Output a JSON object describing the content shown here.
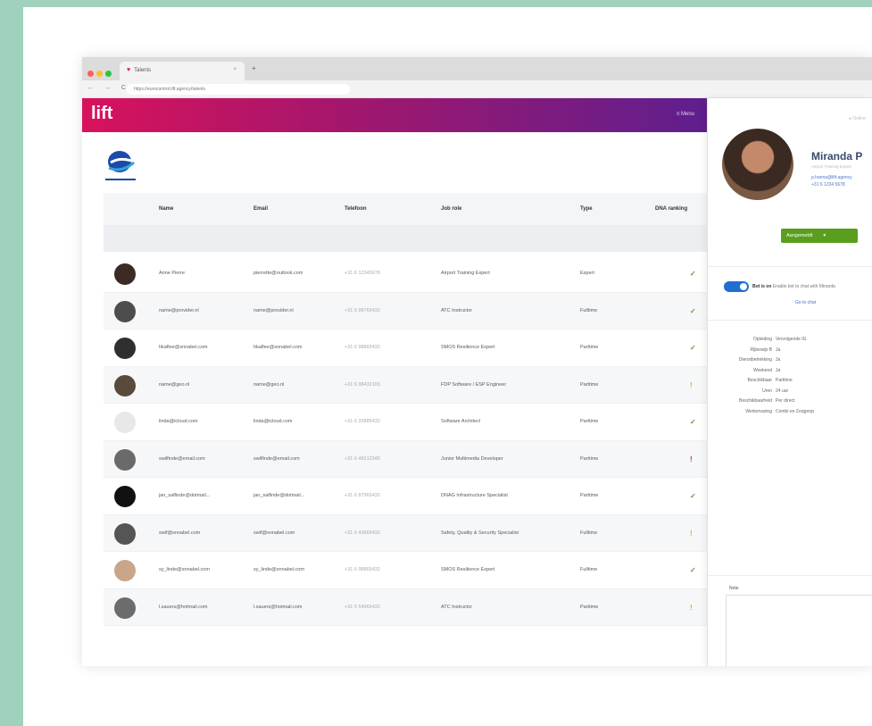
{
  "browser": {
    "tab_title": "Talents",
    "url": "https://eurocontrol.lift.agency/talents",
    "nav": "← → C"
  },
  "app": {
    "logo": "lift",
    "menu_item": "≡ Menu"
  },
  "table": {
    "headers": [
      "Name",
      "Email",
      "Telefoon",
      "Job role",
      "Type",
      "DNA ranking"
    ],
    "rows": [
      {
        "name": "Anne Pierre",
        "email": "pierrette@outlook.com",
        "phone": "+31 6 12345678",
        "role": "Airport Training Expert",
        "type": "Expert",
        "status": "✓",
        "status_color": "#5aa02c",
        "avatar": "#3b2b24"
      },
      {
        "name": "name@provider.nl",
        "email": "name@provider.nl",
        "phone": "+31 6 98765432",
        "role": "ATC Instructor",
        "type": "Fulltime",
        "status": "✓",
        "status_color": "#5aa02c",
        "avatar": "#4d4d4d"
      },
      {
        "name": "hkaflee@snnabel.com",
        "email": "hkaflee@snnabel.com",
        "phone": "+31 6 98865432",
        "role": "SMOS Resilience Expert",
        "type": "Parttime",
        "status": "✓",
        "status_color": "#5aa02c",
        "avatar": "#2f2f2f"
      },
      {
        "name": "name@geo.nl",
        "email": "name@geo.nl",
        "phone": "+31 6 98432165",
        "role": "FDP Software / ESP Engineer",
        "type": "Parttime",
        "status": "!",
        "status_color": "#f2a516",
        "avatar": "#5a4a3a"
      },
      {
        "name": "linda@icloud.com",
        "email": "linda@icloud.com",
        "phone": "+31 6 32885432",
        "role": "Software Architect",
        "type": "Parttime",
        "status": "✓",
        "status_color": "#5aa02c",
        "avatar": "#e8e8e8"
      },
      {
        "name": "swilfinde@email.com",
        "email": "swilfinde@email.com",
        "phone": "+31 6 46512345",
        "role": "Junior Multimedia Developer",
        "type": "Parttime",
        "status": "!",
        "status_color": "#d8262a",
        "avatar": "#6a6a6a"
      },
      {
        "name": "jan_salfinde@dotmail...",
        "email": "jan_salfinde@dotmail...",
        "phone": "+31 6 87965432",
        "role": "DNAG Infrastructure Specialist",
        "type": "Parttime",
        "status": "✓",
        "status_color": "#5aa02c",
        "avatar": "#111111"
      },
      {
        "name": "swif@snnabel.com",
        "email": "swif@snnabel.com",
        "phone": "+31 6 43665432",
        "role": "Safety, Quality & Security Specialist",
        "type": "Fulltime",
        "status": "!",
        "status_color": "#f2a516",
        "avatar": "#555555"
      },
      {
        "name": "sy_linde@snnabel.com",
        "email": "sy_linde@snnabel.com",
        "phone": "+31 6 98865432",
        "role": "SMOS Resilience Expert",
        "type": "Fulltime",
        "status": "✓",
        "status_color": "#5aa02c",
        "avatar": "#c9a68a"
      },
      {
        "name": "l.sauers@hotmail.com",
        "email": "l.sauers@hotmail.com",
        "phone": "+31 6 54965432",
        "role": "ATC Instructor",
        "type": "Parttime",
        "status": "!",
        "status_color": "#f2a516",
        "avatar": "#6c6c6c"
      }
    ]
  },
  "panel": {
    "online": "● Online",
    "name": "Miranda P",
    "subtitle": "Airport Training Expert",
    "email": "p.hanna@lift.agency",
    "phone": "+31 6 1234 5678",
    "action_button": "Aangemeldt",
    "action_caret": "▾",
    "bot_label": "Bot is on",
    "bot_text": " Enable bot to chat with Miranda",
    "go_to_chat": "Go to chat",
    "details": [
      {
        "k": "Opleiding",
        "v": "Vervolgende IG"
      },
      {
        "k": "Rijbewijs B",
        "v": "Ja"
      },
      {
        "k": "Dienstbetrekking",
        "v": "Ja"
      },
      {
        "k": "Weekend",
        "v": "Ja"
      },
      {
        "k": "Beschikbaar",
        "v": "Parttime"
      },
      {
        "k": "Uren",
        "v": "24 uur"
      },
      {
        "k": "Beschikbaarheid",
        "v": "Per direct"
      },
      {
        "k": "Werkervaring",
        "v": "Combi en Zorgprop"
      }
    ],
    "notes_label": "Note"
  },
  "colors": {
    "background": "#9fd1bd",
    "brand_start": "#d8125c",
    "brand_end": "#5e1f8e",
    "ok": "#5aa02c",
    "warn": "#f2a516",
    "error": "#d8262a",
    "button": "#5a9e1e"
  }
}
